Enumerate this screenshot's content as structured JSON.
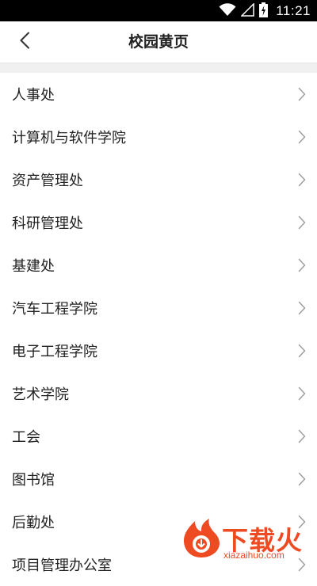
{
  "status_bar": {
    "time": "11:21"
  },
  "header": {
    "title": "校园黄页"
  },
  "list": {
    "items": [
      {
        "label": "人事处"
      },
      {
        "label": "计算机与软件学院"
      },
      {
        "label": "资产管理处"
      },
      {
        "label": "科研管理处"
      },
      {
        "label": "基建处"
      },
      {
        "label": "汽车工程学院"
      },
      {
        "label": "电子工程学院"
      },
      {
        "label": "艺术学院"
      },
      {
        "label": "工会"
      },
      {
        "label": "图书馆"
      },
      {
        "label": "后勤处"
      },
      {
        "label": "项目管理办公室"
      }
    ]
  },
  "watermark": {
    "brand": "下载火",
    "url": "xiazaihuo.com"
  },
  "colors": {
    "status_bar": "#000000",
    "accent": "#ef4b23",
    "separator": "#f0f0f0"
  }
}
